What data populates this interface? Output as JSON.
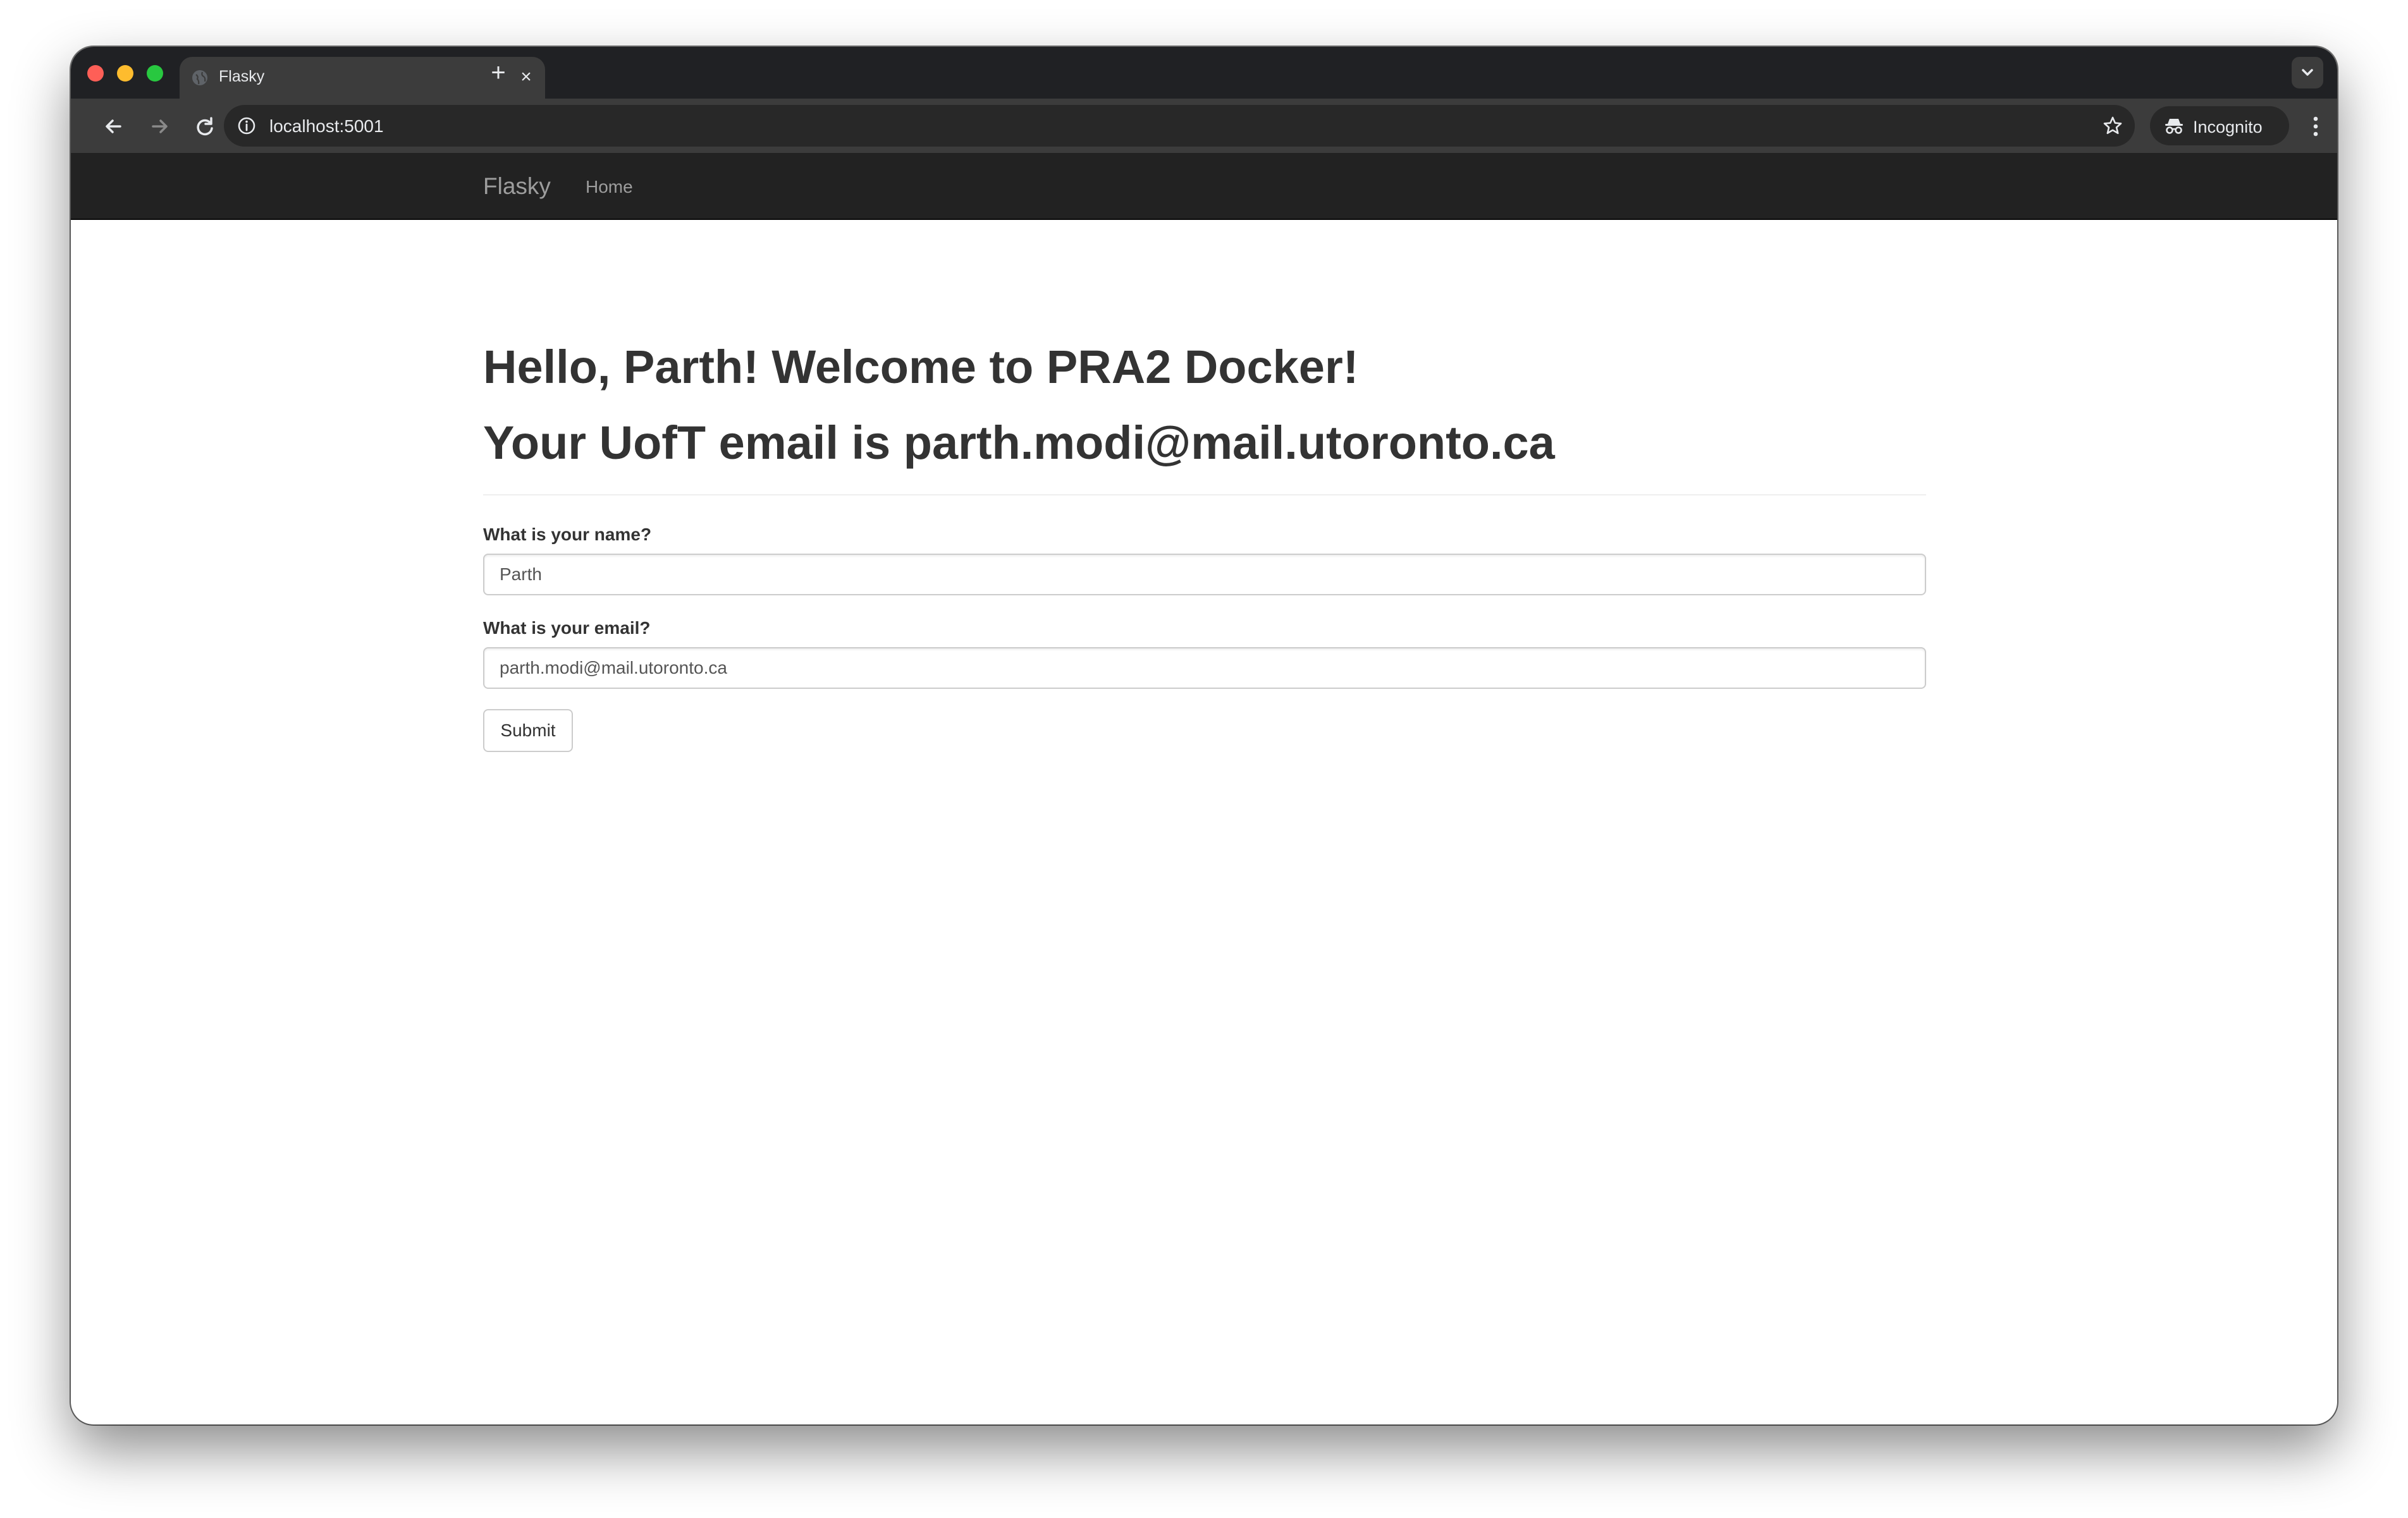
{
  "browser": {
    "tab": {
      "title": "Flasky",
      "close": "×"
    },
    "new_tab": "+",
    "url": "localhost:5001",
    "incognito_label": "Incognito"
  },
  "site": {
    "brand": "Flasky",
    "nav_home": "Home"
  },
  "page": {
    "greeting": "Hello, Parth! Welcome to PRA2 Docker!",
    "email_line": "Your UofT email is parth.modi@mail.utoronto.ca",
    "form": {
      "name_label": "What is your name?",
      "name_value": "Parth",
      "email_label": "What is your email?",
      "email_value": "parth.modi@mail.utoronto.ca",
      "submit_label": "Submit"
    }
  },
  "icons": {
    "back": "back-arrow-icon",
    "forward": "forward-arrow-icon",
    "reload": "reload-icon",
    "info": "info-icon",
    "star": "star-icon",
    "incognito": "incognito-icon",
    "menu": "kebab-menu-icon",
    "tab_search": "chevron-down-icon",
    "favicon": "globe-icon"
  },
  "colors": {
    "site_navbar": "#222222",
    "heading_text": "#333333",
    "browser_frame": "#202124"
  }
}
